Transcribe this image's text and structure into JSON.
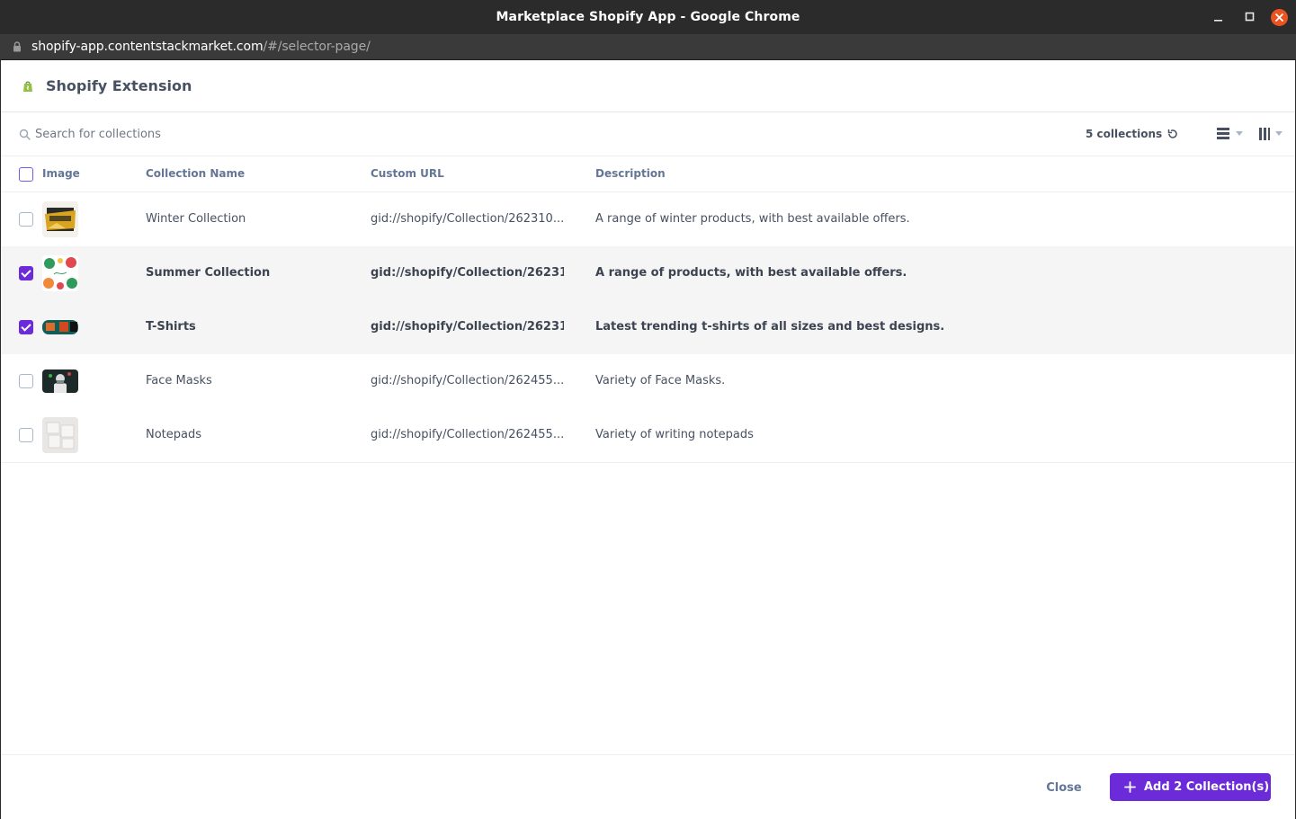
{
  "window": {
    "title": "Marketplace Shopify App - Google Chrome"
  },
  "address_bar": {
    "host": "shopify-app.contentstackmarket.com",
    "path": "/#/selector-page/"
  },
  "app": {
    "title": "Shopify Extension",
    "brand_color": "#95bf47",
    "accent_color": "#6c2bd9"
  },
  "toolbar": {
    "search_placeholder": "Search for collections",
    "count_label": "5 collections"
  },
  "table": {
    "headers": {
      "image": "Image",
      "name": "Collection Name",
      "url": "Custom URL",
      "description": "Description"
    },
    "rows": [
      {
        "name": "Winter Collection",
        "url": "gid://shopify/Collection/262310...",
        "description": "A range of winter products, with best available offers.",
        "selected": false,
        "thumb": "winter-collection-image"
      },
      {
        "name": "Summer Collection",
        "url": "gid://shopify/Collection/26231...",
        "description": "A range of products, with best available offers.",
        "selected": true,
        "thumb": "summer-collection-image"
      },
      {
        "name": "T-Shirts",
        "url": "gid://shopify/Collection/26231...",
        "description": "Latest trending t-shirts of all sizes and best designs.",
        "selected": true,
        "thumb": "t-shirts-image"
      },
      {
        "name": "Face Masks",
        "url": "gid://shopify/Collection/262455...",
        "description": "Variety of Face Masks.",
        "selected": false,
        "thumb": "face-masks-image"
      },
      {
        "name": "Notepads",
        "url": "gid://shopify/Collection/262455...",
        "description": "Variety of writing notepads",
        "selected": false,
        "thumb": "notepads-image"
      }
    ]
  },
  "footer": {
    "close_label": "Close",
    "add_label": "Add 2 Collection(s)"
  }
}
